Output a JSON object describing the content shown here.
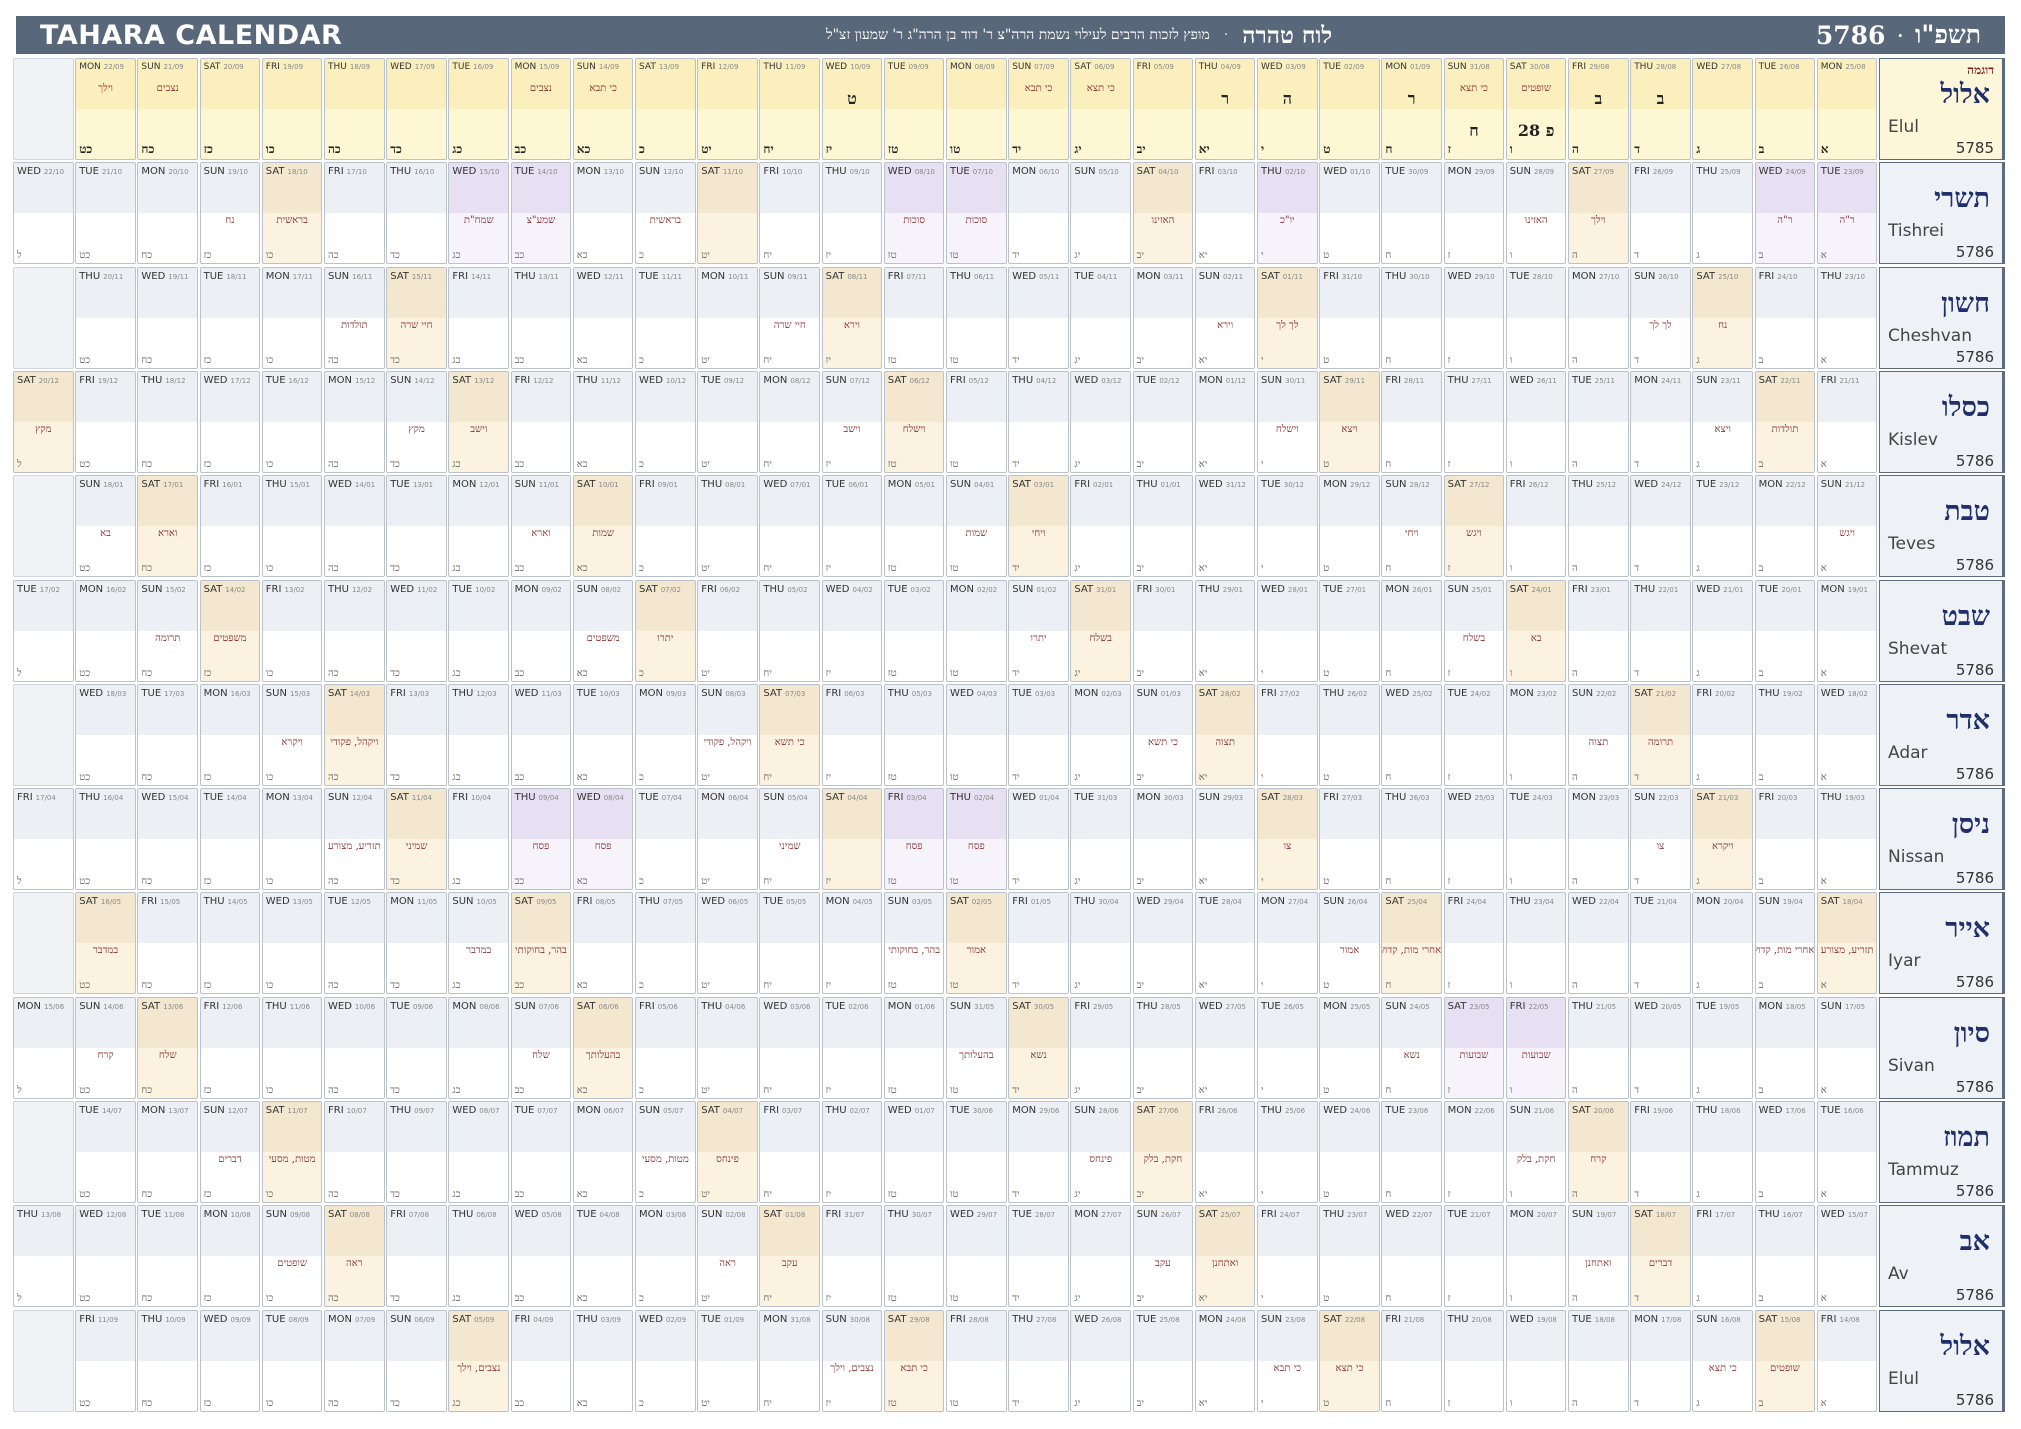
{
  "header": {
    "title": "TAHARA CALENDAR",
    "center_title": "לוח טהרה",
    "separator": "·",
    "subtitle": "מופץ לזכות הרבים לעילוי נשמת הרה\"צ ר' דוד בן הרה\"ג ר' שמעון זצ\"ל",
    "year_heb": "תשפ\"ו",
    "year_num": "5786"
  },
  "sample_tag": "דוגמה",
  "heb_days": [
    "א",
    "ב",
    "ג",
    "ד",
    "ה",
    "ו",
    "ז",
    "ח",
    "ט",
    "י",
    "יא",
    "יב",
    "יג",
    "יד",
    "טו",
    "טז",
    "יז",
    "יח",
    "יט",
    "כ",
    "כא",
    "כב",
    "כג",
    "כד",
    "כה",
    "כו",
    "כז",
    "כח",
    "כט",
    "ל"
  ],
  "months": [
    {
      "heb": "אלול",
      "eng": "Elul",
      "year": "5785",
      "len": 29,
      "start": 0,
      "sample": true,
      "dates": [
        "MON 25/08",
        "TUE 26/08",
        "WED 27/08",
        "THU 28/08",
        "FRI 29/08",
        "SAT 30/08",
        "SUN 31/08",
        "MON 01/09",
        "TUE 02/09",
        "WED 03/09",
        "THU 04/09",
        "FRI 05/09",
        "SAT 06/09",
        "SUN 07/09",
        "MON 08/09",
        "TUE 09/09",
        "WED 10/09",
        "THU 11/09",
        "FRI 12/09",
        "SAT 13/09",
        "SUN 14/09",
        "MON 15/09",
        "TUE 16/09",
        "WED 17/09",
        "THU 18/09",
        "FRI 19/09",
        "SAT 20/09",
        "SUN 21/09",
        "MON 22/09"
      ],
      "events": {
        "6": "שופטים",
        "7": "כי תצא",
        "13": "כי תצא",
        "14": "כי תבא",
        "21": "כי תבא",
        "22": "נצבים",
        "28": "נצבים",
        "29": "וילך"
      },
      "marks": {
        "4": "ב",
        "5": "ב",
        "6": "פ 28",
        "7": "ח",
        "8": "ר",
        "10": "ה",
        "11": "ר",
        "17": "ט"
      }
    },
    {
      "heb": "תשרי",
      "eng": "Tishrei",
      "year": "5786",
      "len": 30,
      "start": 0,
      "dates": [
        "TUE 23/09",
        "WED 24/09",
        "THU 25/09",
        "FRI 26/09",
        "SAT 27/09",
        "SUN 28/09",
        "MON 29/09",
        "TUE 30/09",
        "WED 01/10",
        "THU 02/10",
        "FRI 03/10",
        "SAT 04/10",
        "SUN 05/10",
        "MON 06/10",
        "TUE 07/10",
        "WED 08/10",
        "THU 09/10",
        "FRI 10/10",
        "SAT 11/10",
        "SUN 12/10",
        "MON 13/10",
        "TUE 14/10",
        "WED 15/10",
        "THU 16/10",
        "FRI 17/10",
        "SAT 18/10",
        "SUN 19/10",
        "MON 20/10",
        "TUE 21/10",
        "WED 22/10"
      ],
      "events": {
        "1": "ר\"ה",
        "2": "ר\"ה",
        "5": "וילך",
        "6": "האזינו",
        "10": "יו\"כ",
        "12": "האזינו",
        "15": "סוכות",
        "16": "סוכות",
        "20": "בראשית",
        "22": "שמע\"צ",
        "23": "שמח\"ת",
        "26": "בראשית",
        "27": "נח"
      },
      "holy": [
        1,
        2,
        10,
        15,
        16,
        22,
        23
      ]
    },
    {
      "heb": "חשון",
      "eng": "Cheshvan",
      "year": "5786",
      "len": 29,
      "start": 0,
      "dates": [
        "THU 23/10",
        "FRI 24/10",
        "SAT 25/10",
        "SUN 26/10",
        "MON 27/10",
        "TUE 28/10",
        "WED 29/10",
        "THU 30/10",
        "FRI 31/10",
        "SAT 01/11",
        "SUN 02/11",
        "MON 03/11",
        "TUE 04/11",
        "WED 05/11",
        "THU 06/11",
        "FRI 07/11",
        "SAT 08/11",
        "SUN 09/11",
        "MON 10/11",
        "TUE 11/11",
        "WED 12/11",
        "THU 13/11",
        "FRI 14/11",
        "SAT 15/11",
        "SUN 16/11",
        "MON 17/11",
        "TUE 18/11",
        "WED 19/11",
        "THU 20/11"
      ],
      "events": {
        "3": "נח",
        "4": "לך לך",
        "10": "לך לך",
        "11": "וירא",
        "17": "וירא",
        "18": "חיי שרה",
        "24": "חיי שרה",
        "25": "תולדות"
      }
    },
    {
      "heb": "כסלו",
      "eng": "Kislev",
      "year": "5786",
      "len": 30,
      "start": 0,
      "dates": [
        "FRI 21/11",
        "SAT 22/11",
        "SUN 23/11",
        "MON 24/11",
        "TUE 25/11",
        "WED 26/11",
        "THU 27/11",
        "FRI 28/11",
        "SAT 29/11",
        "SUN 30/11",
        "MON 01/12",
        "TUE 02/12",
        "WED 03/12",
        "THU 04/12",
        "FRI 05/12",
        "SAT 06/12",
        "SUN 07/12",
        "MON 08/12",
        "TUE 09/12",
        "WED 10/12",
        "THU 11/12",
        "FRI 12/12",
        "SAT 13/12",
        "SUN 14/12",
        "MON 15/12",
        "TUE 16/12",
        "WED 17/12",
        "THU 18/12",
        "FRI 19/12",
        "SAT 20/12"
      ],
      "events": {
        "2": "תולדות",
        "3": "ויצא",
        "9": "ויצא",
        "10": "וישלח",
        "16": "וישלח",
        "17": "וישב",
        "23": "וישב",
        "24": "מקץ",
        "30": "מקץ"
      }
    },
    {
      "heb": "טבת",
      "eng": "Teves",
      "year": "5786",
      "len": 29,
      "start": 0,
      "dates": [
        "SUN 21/12",
        "MON 22/12",
        "TUE 23/12",
        "WED 24/12",
        "THU 25/12",
        "FRI 26/12",
        "SAT 27/12",
        "SUN 28/12",
        "MON 29/12",
        "TUE 30/12",
        "WED 31/12",
        "THU 01/01",
        "FRI 02/01",
        "SAT 03/01",
        "SUN 04/01",
        "MON 05/01",
        "TUE 06/01",
        "WED 07/01",
        "THU 08/01",
        "FRI 09/01",
        "SAT 10/01",
        "SUN 11/01",
        "MON 12/01",
        "TUE 13/01",
        "WED 14/01",
        "THU 15/01",
        "FRI 16/01",
        "SAT 17/01",
        "SUN 18/01"
      ],
      "events": {
        "1": "ויגש",
        "7": "ויגש",
        "8": "ויחי",
        "14": "ויחי",
        "15": "שמות",
        "21": "שמות",
        "22": "וארא",
        "28": "וארא",
        "29": "בא"
      }
    },
    {
      "heb": "שבט",
      "eng": "Shevat",
      "year": "5786",
      "len": 30,
      "start": 0,
      "dates": [
        "MON 19/01",
        "TUE 20/01",
        "WED 21/01",
        "THU 22/01",
        "FRI 23/01",
        "SAT 24/01",
        "SUN 25/01",
        "MON 26/01",
        "TUE 27/01",
        "WED 28/01",
        "THU 29/01",
        "FRI 30/01",
        "SAT 31/01",
        "SUN 01/02",
        "MON 02/02",
        "TUE 03/02",
        "WED 04/02",
        "THU 05/02",
        "FRI 06/02",
        "SAT 07/02",
        "SUN 08/02",
        "MON 09/02",
        "TUE 10/02",
        "WED 11/02",
        "THU 12/02",
        "FRI 13/02",
        "SAT 14/02",
        "SUN 15/02",
        "MON 16/02",
        "TUE 17/02"
      ],
      "events": {
        "6": "בא",
        "7": "בשלח",
        "13": "בשלח",
        "14": "יתרו",
        "20": "יתרו",
        "21": "משפטים",
        "27": "משפטים",
        "28": "תרומה"
      }
    },
    {
      "heb": "אדר",
      "eng": "Adar",
      "year": "5786",
      "len": 29,
      "start": 0,
      "dates": [
        "WED 18/02",
        "THU 19/02",
        "FRI 20/02",
        "SAT 21/02",
        "SUN 22/02",
        "MON 23/02",
        "TUE 24/02",
        "WED 25/02",
        "THU 26/02",
        "FRI 27/02",
        "SAT 28/02",
        "SUN 01/03",
        "MON 02/03",
        "TUE 03/03",
        "WED 04/03",
        "THU 05/03",
        "FRI 06/03",
        "SAT 07/03",
        "SUN 08/03",
        "MON 09/03",
        "TUE 10/03",
        "WED 11/03",
        "THU 12/03",
        "FRI 13/03",
        "SAT 14/03",
        "SUN 15/03",
        "MON 16/03",
        "TUE 17/03",
        "WED 18/03"
      ],
      "events": {
        "4": "תרומה",
        "5": "תצוה",
        "11": "תצוה",
        "12": "כי תשא",
        "18": "כי תשא",
        "19": "ויקהל, פקודי",
        "25": "ויקהל, פקודי",
        "26": "ויקרא"
      }
    },
    {
      "heb": "ניסן",
      "eng": "Nissan",
      "year": "5786",
      "len": 30,
      "start": 0,
      "dates": [
        "THU 19/03",
        "FRI 20/03",
        "SAT 21/03",
        "SUN 22/03",
        "MON 23/03",
        "TUE 24/03",
        "WED 25/03",
        "THU 26/03",
        "FRI 27/03",
        "SAT 28/03",
        "SUN 29/03",
        "MON 30/03",
        "TUE 31/03",
        "WED 01/04",
        "THU 02/04",
        "FRI 03/04",
        "SAT 04/04",
        "SUN 05/04",
        "MON 06/04",
        "TUE 07/04",
        "WED 08/04",
        "THU 09/04",
        "FRI 10/04",
        "SAT 11/04",
        "SUN 12/04",
        "MON 13/04",
        "TUE 14/04",
        "WED 15/04",
        "THU 16/04",
        "FRI 17/04"
      ],
      "events": {
        "3": "ויקרא",
        "4": "צו",
        "10": "צו",
        "15": "פסח",
        "16": "פסח",
        "18": "שמיני",
        "21": "פסח",
        "22": "פסח",
        "24": "שמיני",
        "25": "תזריע, מצורע"
      },
      "holy": [
        15,
        16,
        21,
        22
      ]
    },
    {
      "heb": "אייר",
      "eng": "Iyar",
      "year": "5786",
      "len": 29,
      "start": 0,
      "dates": [
        "SAT 18/04",
        "SUN 19/04",
        "MON 20/04",
        "TUE 21/04",
        "WED 22/04",
        "THU 23/04",
        "FRI 24/04",
        "SAT 25/04",
        "SUN 26/04",
        "MON 27/04",
        "TUE 28/04",
        "WED 29/04",
        "THU 30/04",
        "FRI 01/05",
        "SAT 02/05",
        "SUN 03/05",
        "MON 04/05",
        "TUE 05/05",
        "WED 06/05",
        "THU 07/05",
        "FRI 08/05",
        "SAT 09/05",
        "SUN 10/05",
        "MON 11/05",
        "TUE 12/05",
        "WED 13/05",
        "THU 14/05",
        "FRI 15/05",
        "SAT 16/05"
      ],
      "events": {
        "1": "תזריע, מצורע",
        "2": "אחרי מות, קדושים",
        "8": "אחרי מות, קדושים",
        "9": "אמור",
        "15": "אמור",
        "16": "בהר, בחוקותי",
        "22": "בהר, בחוקותי",
        "23": "במדבר",
        "29": "במדבר"
      }
    },
    {
      "heb": "סיון",
      "eng": "Sivan",
      "year": "5786",
      "len": 30,
      "start": 0,
      "dates": [
        "SUN 17/05",
        "MON 18/05",
        "TUE 19/05",
        "WED 20/05",
        "THU 21/05",
        "FRI 22/05",
        "SAT 23/05",
        "SUN 24/05",
        "MON 25/05",
        "TUE 26/05",
        "WED 27/05",
        "THU 28/05",
        "FRI 29/05",
        "SAT 30/05",
        "SUN 31/05",
        "MON 01/06",
        "TUE 02/06",
        "WED 03/06",
        "THU 04/06",
        "FRI 05/06",
        "SAT 06/06",
        "SUN 07/06",
        "MON 08/06",
        "TUE 09/06",
        "WED 10/06",
        "THU 11/06",
        "FRI 12/06",
        "SAT 13/06",
        "SUN 14/06",
        "MON 15/06"
      ],
      "events": {
        "6": "שבועות",
        "7": "שבועות",
        "8": "נשא",
        "14": "נשא",
        "15": "בהעלותך",
        "21": "בהעלותך",
        "22": "שלח",
        "28": "שלח",
        "29": "קרח"
      },
      "holy": [
        6,
        7
      ]
    },
    {
      "heb": "תמוז",
      "eng": "Tammuz",
      "year": "5786",
      "len": 29,
      "start": 0,
      "dates": [
        "TUE 16/06",
        "WED 17/06",
        "THU 18/06",
        "FRI 19/06",
        "SAT 20/06",
        "SUN 21/06",
        "MON 22/06",
        "TUE 23/06",
        "WED 24/06",
        "THU 25/06",
        "FRI 26/06",
        "SAT 27/06",
        "SUN 28/06",
        "MON 29/06",
        "TUE 30/06",
        "WED 01/07",
        "THU 02/07",
        "FRI 03/07",
        "SAT 04/07",
        "SUN 05/07",
        "MON 06/07",
        "TUE 07/07",
        "WED 08/07",
        "THU 09/07",
        "FRI 10/07",
        "SAT 11/07",
        "SUN 12/07",
        "MON 13/07",
        "TUE 14/07"
      ],
      "events": {
        "5": "קרח",
        "6": "חקת, בלק",
        "12": "חקת, בלק",
        "13": "פינחס",
        "19": "פינחס",
        "20": "מטות, מסעי",
        "26": "מטות, מסעי",
        "27": "דברים"
      }
    },
    {
      "heb": "אב",
      "eng": "Av",
      "year": "5786",
      "len": 30,
      "start": 0,
      "dates": [
        "WED 15/07",
        "THU 16/07",
        "FRI 17/07",
        "SAT 18/07",
        "SUN 19/07",
        "MON 20/07",
        "TUE 21/07",
        "WED 22/07",
        "THU 23/07",
        "FRI 24/07",
        "SAT 25/07",
        "SUN 26/07",
        "MON 27/07",
        "TUE 28/07",
        "WED 29/07",
        "THU 30/07",
        "FRI 31/07",
        "SAT 01/08",
        "SUN 02/08",
        "MON 03/08",
        "TUE 04/08",
        "WED 05/08",
        "THU 06/08",
        "FRI 07/08",
        "SAT 08/08",
        "SUN 09/08",
        "MON 10/08",
        "TUE 11/08",
        "WED 12/08",
        "THU 13/08"
      ],
      "events": {
        "4": "דברים",
        "5": "ואתחנן",
        "11": "ואתחנן",
        "12": "עקב",
        "18": "עקב",
        "19": "ראה",
        "25": "ראה",
        "26": "שופטים"
      }
    },
    {
      "heb": "אלול",
      "eng": "Elul",
      "year": "5786",
      "len": 29,
      "start": 0,
      "dates": [
        "FRI 14/08",
        "SAT 15/08",
        "SUN 16/08",
        "MON 17/08",
        "TUE 18/08",
        "WED 19/08",
        "THU 20/08",
        "FRI 21/08",
        "SAT 22/08",
        "SUN 23/08",
        "MON 24/08",
        "TUE 25/08",
        "WED 26/08",
        "THU 27/08",
        "FRI 28/08",
        "SAT 29/08",
        "SUN 30/08",
        "MON 31/08",
        "TUE 01/09",
        "WED 02/09",
        "THU 03/09",
        "FRI 04/09",
        "SAT 05/09",
        "SUN 06/09",
        "MON 07/09",
        "TUE 08/09",
        "WED 09/09",
        "THU 10/09",
        "FRI 11/09"
      ],
      "events": {
        "2": "שופטים",
        "3": "כי תצא",
        "9": "כי תצא",
        "10": "כי תבא",
        "16": "כי תבא",
        "17": "נצבים, וילך",
        "23": "נצבים, וילך"
      }
    }
  ]
}
